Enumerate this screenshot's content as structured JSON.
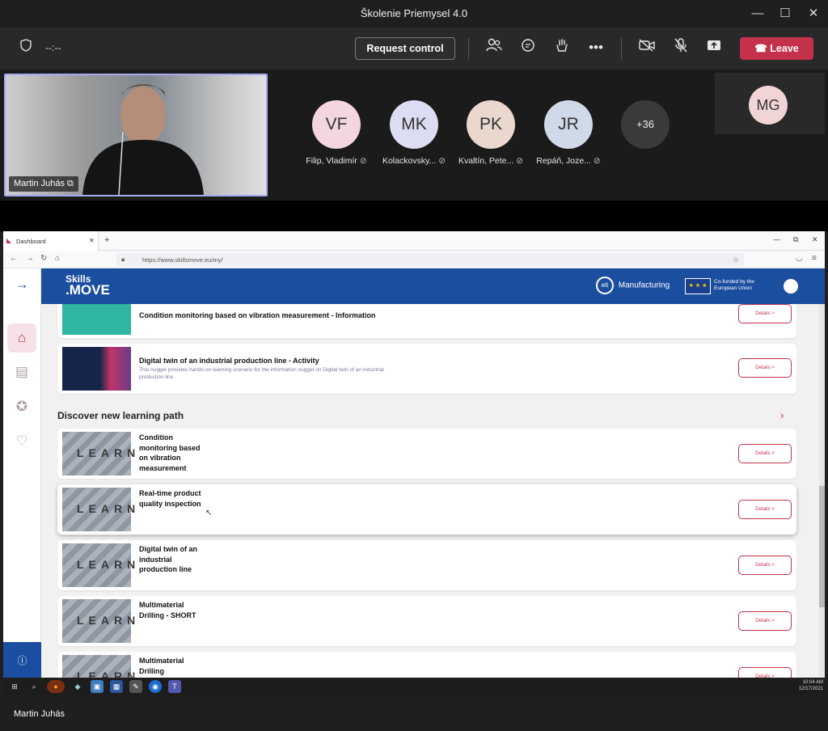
{
  "window": {
    "title": "Školenie Priemysel 4.0",
    "minimize": "—",
    "maximize": "☐",
    "close": "✕"
  },
  "meeting_toolbar": {
    "timer": "--:--",
    "request_control_label": "Request control",
    "leave_label": "Leave"
  },
  "presenter": {
    "name": "Martin Juhás"
  },
  "participants": [
    {
      "initials": "VF",
      "name": "Filip, Vladimír",
      "color": "#f3d6df"
    },
    {
      "initials": "MK",
      "name": "Kolackovsky...",
      "color": "#dcdcf2"
    },
    {
      "initials": "PK",
      "name": "Kvaltín, Pete...",
      "color": "#ead8cf"
    },
    {
      "initials": "JR",
      "name": "Repáň, Joze...",
      "color": "#cfd9e8"
    }
  ],
  "overflow_count": "+36",
  "spotlight": {
    "initials": "MG",
    "color": "#f1d4d6"
  },
  "browser": {
    "tab_label": "Dashboard",
    "new_tab": "+",
    "url": "https://www.skillsmove.eu/my/"
  },
  "site": {
    "logo_line1": "Skills",
    "logo_line2": ".MOVE",
    "eit_label": "eit",
    "eit_text": "Manufacturing",
    "eu_text": "Co-funded by the European Union"
  },
  "cards_top": [
    {
      "title": "Condition monitoring based on vibration measurement - Information",
      "desc": "",
      "details": "Details >"
    },
    {
      "title": "Digital twin of an industrial production line - Activity",
      "desc": "This nugget provides hands-on learning scenario for the information nugget on Digital twin of an industrial production line",
      "details": "Details >"
    }
  ],
  "section": {
    "title": "Discover new learning path",
    "arrow": "›"
  },
  "learning_paths": [
    {
      "title": "Condition monitoring based on vibration measurement",
      "details": "Details >"
    },
    {
      "title": "Real-time product quality inspection",
      "details": "Details >"
    },
    {
      "title": "Digital twin of an industrial production line",
      "details": "Details >"
    },
    {
      "title": "Multimaterial Drilling - SHORT",
      "details": "Details >"
    },
    {
      "title": "Multimaterial Drilling",
      "details": "Details >"
    }
  ],
  "thumb_text": "LEARN",
  "taskbar": {
    "time": "10:04 AM",
    "date": "12/17/2021"
  },
  "footer": {
    "presenter_name": "Martin Juhás"
  }
}
